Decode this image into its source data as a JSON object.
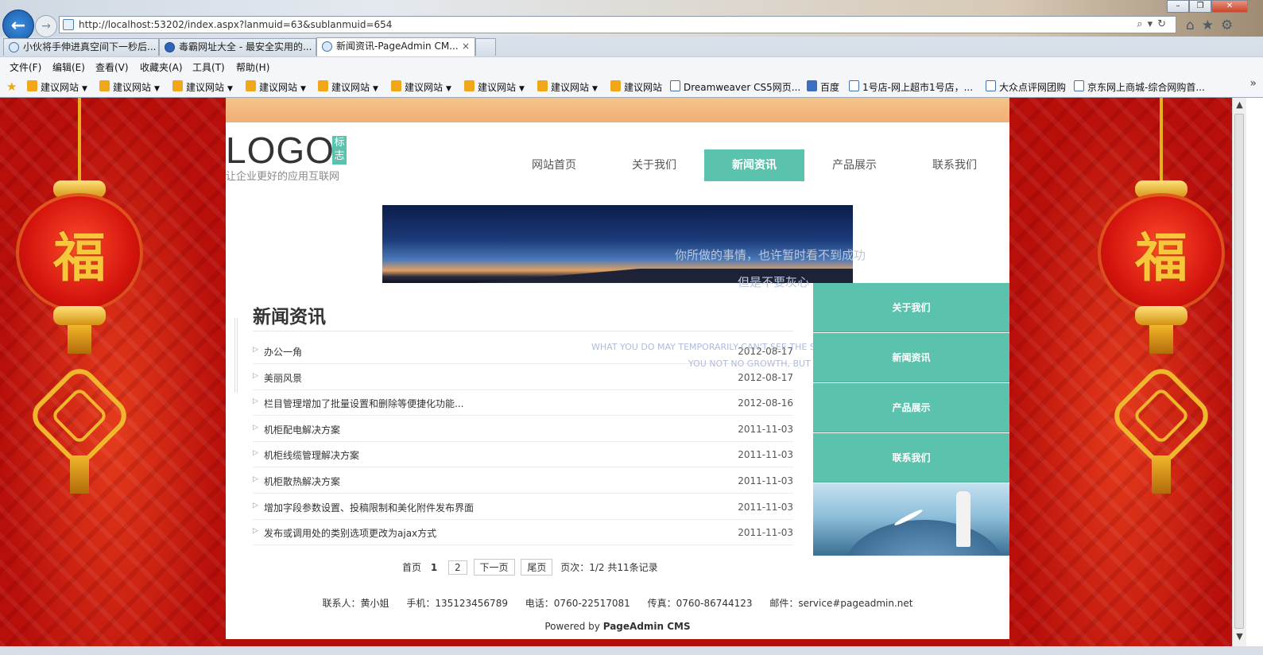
{
  "browser": {
    "address_url": "http://localhost:53202/index.aspx?lanmuid=63&sublanmuid=654",
    "tabs": [
      {
        "label": "小伙将手伸进真空间下一秒后..."
      },
      {
        "label": "毒霸网址大全 - 最安全实用的..."
      },
      {
        "label": "新闻资讯-PageAdmin CM...",
        "close": "×"
      }
    ],
    "menu": [
      "文件(F)",
      "编辑(E)",
      "查看(V)",
      "收藏夹(A)",
      "工具(T)",
      "帮助(H)"
    ],
    "favorites": [
      {
        "label": "建议网站",
        "caret": "▼"
      },
      {
        "label": "建议网站",
        "caret": "▼"
      },
      {
        "label": "建议网站",
        "caret": "▼"
      },
      {
        "label": "建议网站",
        "caret": "▼"
      },
      {
        "label": "建议网站",
        "caret": "▼"
      },
      {
        "label": "建议网站",
        "caret": "▼"
      },
      {
        "label": "建议网站",
        "caret": "▼"
      },
      {
        "label": "建议网站",
        "caret": "▼"
      },
      {
        "label": "建议网站",
        "caret": ""
      },
      {
        "label": "Dreamweaver CS5网页..."
      },
      {
        "label": "百度"
      },
      {
        "label": "1号店-网上超市1号店，..."
      },
      {
        "label": "大众点评网团购"
      },
      {
        "label": "京东网上商城-综合网购首..."
      }
    ]
  },
  "site": {
    "logo": "LOGO",
    "logo_badge": "标志",
    "slogan": "让企业更好的应用互联网",
    "nav": [
      {
        "label": "网站首页"
      },
      {
        "label": "关于我们"
      },
      {
        "label": "新闻资讯"
      },
      {
        "label": "产品展示"
      },
      {
        "label": "联系我们"
      }
    ],
    "banner": {
      "caption_line1": "你所做的事情，也许暂时看不到成功",
      "caption_line2": "但是不要灰心",
      "english_line1": "WHAT YOU DO MAY TEMPORARILY CAN'T SEE THE S",
      "english_line2": "YOU NOT NO GROWTH, BUT T"
    },
    "section_title": "新闻资讯",
    "news": [
      {
        "title": "办公一角",
        "date": "2012-08-17"
      },
      {
        "title": "美丽风景",
        "date": "2012-08-17"
      },
      {
        "title": "栏目管理增加了批量设置和删除等便捷化功能...",
        "date": "2012-08-16"
      },
      {
        "title": "机柜配电解决方案",
        "date": "2011-11-03"
      },
      {
        "title": "机柜线缆管理解决方案",
        "date": "2011-11-03"
      },
      {
        "title": "机柜散热解决方案",
        "date": "2011-11-03"
      },
      {
        "title": "增加字段参数设置、投稿限制和美化附件发布界面",
        "date": "2011-11-03"
      },
      {
        "title": "发布或调用处的类别选项更改为ajax方式",
        "date": "2011-11-03"
      }
    ],
    "pager": {
      "first": "首页",
      "current": "1",
      "page2": "2",
      "next": "下一页",
      "last": "尾页",
      "page_info": "页次：1/2 共11条记录"
    },
    "sidebar": [
      {
        "label": "关于我们"
      },
      {
        "label": "新闻资讯"
      },
      {
        "label": "产品展示"
      },
      {
        "label": "联系我们"
      }
    ],
    "footer": {
      "contact_person": "联系人：黄小姐",
      "mobile": "手机：135123456789",
      "phone": "电话：0760-22517081",
      "fax": "传真：0760-86744123",
      "email": "邮件：service#pageadmin.net",
      "powered_prefix": "Powered by",
      "powered_brand": "PageAdmin CMS"
    },
    "lantern_char": "福",
    "colors": {
      "accent": "#5bc2ad",
      "background_red": "#c9150f"
    }
  }
}
